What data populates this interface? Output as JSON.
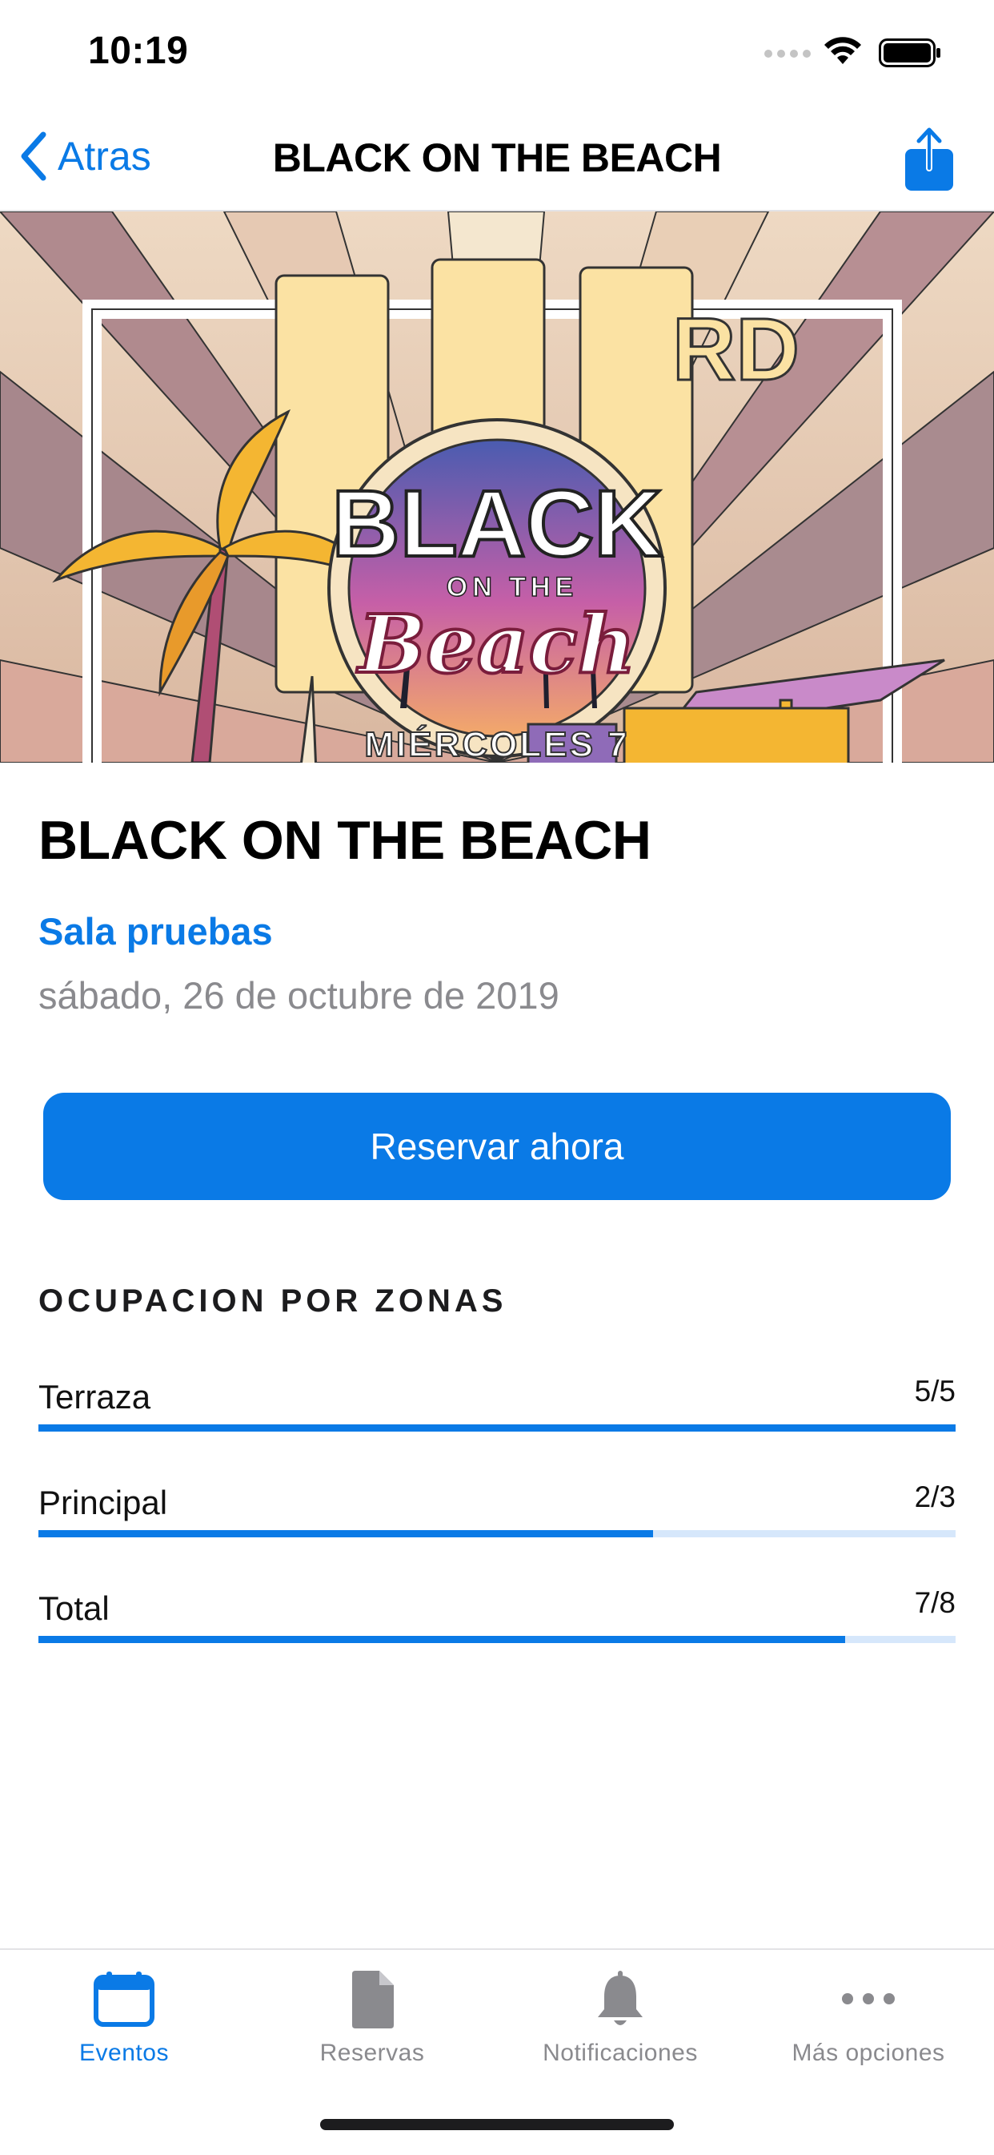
{
  "status_bar": {
    "time": "10:19"
  },
  "nav": {
    "back_label": "Atras",
    "title": "BLACK ON THE BEACH"
  },
  "banner": {
    "logo_line1": "BLACK",
    "logo_line2": "ON THE",
    "logo_line3": "Beach",
    "top_text": "RD",
    "bottom_text": "MIÉRCOLES 7"
  },
  "event": {
    "title": "BLACK ON THE BEACH",
    "venue": "Sala pruebas",
    "date": "sábado, 26 de octubre de 2019",
    "reserve_label": "Reservar ahora"
  },
  "occupancy": {
    "heading": "OCUPACION POR ZONAS",
    "zones": [
      {
        "name": "Terraza",
        "count": "5/5",
        "fill": 1.0
      },
      {
        "name": "Principal",
        "count": "2/3",
        "fill": 0.67
      },
      {
        "name": "Total",
        "count": "7/8",
        "fill": 0.88
      }
    ]
  },
  "tab_bar": {
    "tabs": [
      {
        "label": "Eventos",
        "icon": "calendar-icon",
        "active": true
      },
      {
        "label": "Reservas",
        "icon": "document-icon",
        "active": false
      },
      {
        "label": "Notificaciones",
        "icon": "bell-icon",
        "active": false
      },
      {
        "label": "Más opciones",
        "icon": "more-icon",
        "active": false
      }
    ]
  },
  "colors": {
    "accent": "#0a7ae6",
    "secondary_text": "#8a8a8e",
    "track": "#d6e7fb"
  }
}
